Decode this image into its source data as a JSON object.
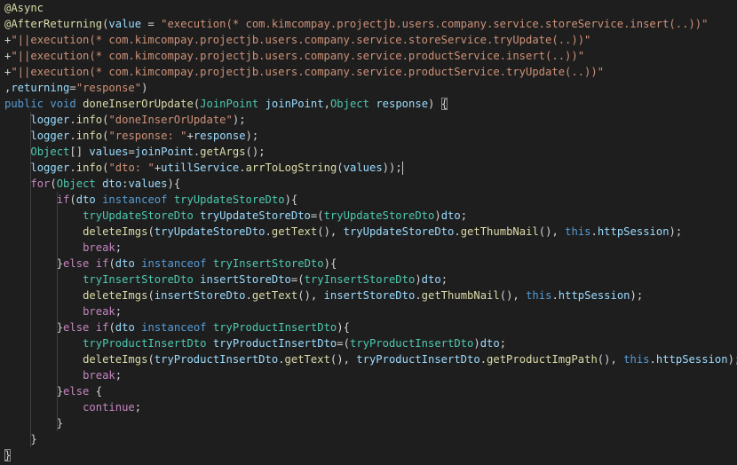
{
  "editor": {
    "theme": {
      "background": "#1e1e1e",
      "text": "#d4d4d4",
      "annotation": "#dcdcaa",
      "string": "#ce9178",
      "keyword": "#569cd6",
      "control": "#c586c0",
      "type": "#4ec9b0",
      "function": "#dcdcaa",
      "variable": "#9cdcfe"
    },
    "lines": [
      [
        [
          "ann",
          "@Async"
        ]
      ],
      [
        [
          "ann",
          "@AfterReturning"
        ],
        [
          "punc",
          "("
        ],
        [
          "var",
          "value"
        ],
        [
          "punc",
          " = "
        ],
        [
          "str",
          "\"execution(* com.kimcompay.projectjb.users.company.service.storeService.insert(..))\""
        ]
      ],
      [
        [
          "punc",
          "+"
        ],
        [
          "str",
          "\"||execution(* com.kimcompay.projectjb.users.company.service.storeService.tryUpdate(..))\""
        ]
      ],
      [
        [
          "punc",
          "+"
        ],
        [
          "str",
          "\"||execution(* com.kimcompay.projectjb.users.company.service.productService.insert(..))\""
        ]
      ],
      [
        [
          "punc",
          "+"
        ],
        [
          "str",
          "\"||execution(* com.kimcompay.projectjb.users.company.service.productService.tryUpdate(..))\""
        ]
      ],
      [
        [
          "punc",
          ","
        ],
        [
          "var",
          "returning"
        ],
        [
          "punc",
          "="
        ],
        [
          "str",
          "\"response\""
        ],
        [
          "punc",
          ")"
        ]
      ],
      [
        [
          "kw",
          "public"
        ],
        [
          "punc",
          " "
        ],
        [
          "kw",
          "void"
        ],
        [
          "punc",
          " "
        ],
        [
          "fn",
          "doneInserOrUpdate"
        ],
        [
          "punc",
          "("
        ],
        [
          "type",
          "JoinPoint"
        ],
        [
          "punc",
          " "
        ],
        [
          "var",
          "joinPoint"
        ],
        [
          "punc",
          ","
        ],
        [
          "type",
          "Object"
        ],
        [
          "punc",
          " "
        ],
        [
          "var",
          "response"
        ],
        [
          "punc",
          ") "
        ],
        [
          "brace",
          "{"
        ]
      ],
      [
        [
          "punc",
          "    "
        ],
        [
          "var",
          "logger"
        ],
        [
          "punc",
          "."
        ],
        [
          "fn",
          "info"
        ],
        [
          "punc",
          "("
        ],
        [
          "str",
          "\"doneInserOrUpdate\""
        ],
        [
          "punc",
          ");"
        ]
      ],
      [
        [
          "punc",
          "    "
        ],
        [
          "var",
          "logger"
        ],
        [
          "punc",
          "."
        ],
        [
          "fn",
          "info"
        ],
        [
          "punc",
          "("
        ],
        [
          "str",
          "\"response: \""
        ],
        [
          "punc",
          "+"
        ],
        [
          "var",
          "response"
        ],
        [
          "punc",
          ");"
        ]
      ],
      [
        [
          "punc",
          "    "
        ],
        [
          "type",
          "Object"
        ],
        [
          "punc",
          "[] "
        ],
        [
          "var",
          "values"
        ],
        [
          "punc",
          "="
        ],
        [
          "var",
          "joinPoint"
        ],
        [
          "punc",
          "."
        ],
        [
          "fn",
          "getArgs"
        ],
        [
          "punc",
          "();"
        ]
      ],
      [
        [
          "punc",
          "    "
        ],
        [
          "var",
          "logger"
        ],
        [
          "punc",
          "."
        ],
        [
          "fn",
          "info"
        ],
        [
          "punc",
          "("
        ],
        [
          "str",
          "\"dto: \""
        ],
        [
          "punc",
          "+"
        ],
        [
          "var",
          "utillService"
        ],
        [
          "punc",
          "."
        ],
        [
          "fn",
          "arrToLogString"
        ],
        [
          "punc",
          "("
        ],
        [
          "var",
          "values"
        ],
        [
          "punc",
          "));"
        ],
        [
          "cursor",
          ""
        ]
      ],
      [
        [
          "punc",
          "    "
        ],
        [
          "ctl",
          "for"
        ],
        [
          "punc",
          "("
        ],
        [
          "type",
          "Object"
        ],
        [
          "punc",
          " "
        ],
        [
          "var",
          "dto"
        ],
        [
          "punc",
          ":"
        ],
        [
          "var",
          "values"
        ],
        [
          "punc",
          "){"
        ]
      ],
      [
        [
          "punc",
          "        "
        ],
        [
          "ctl",
          "if"
        ],
        [
          "punc",
          "("
        ],
        [
          "var",
          "dto"
        ],
        [
          "punc",
          " "
        ],
        [
          "kw",
          "instanceof"
        ],
        [
          "punc",
          " "
        ],
        [
          "type",
          "tryUpdateStoreDto"
        ],
        [
          "punc",
          "){"
        ]
      ],
      [
        [
          "punc",
          "            "
        ],
        [
          "type",
          "tryUpdateStoreDto"
        ],
        [
          "punc",
          " "
        ],
        [
          "var",
          "tryUpdateStoreDto"
        ],
        [
          "punc",
          "=("
        ],
        [
          "type",
          "tryUpdateStoreDto"
        ],
        [
          "punc",
          ")"
        ],
        [
          "var",
          "dto"
        ],
        [
          "punc",
          ";"
        ]
      ],
      [
        [
          "punc",
          "            "
        ],
        [
          "fn",
          "deleteImgs"
        ],
        [
          "punc",
          "("
        ],
        [
          "var",
          "tryUpdateStoreDto"
        ],
        [
          "punc",
          "."
        ],
        [
          "fn",
          "getText"
        ],
        [
          "punc",
          "(), "
        ],
        [
          "var",
          "tryUpdateStoreDto"
        ],
        [
          "punc",
          "."
        ],
        [
          "fn",
          "getThumbNail"
        ],
        [
          "punc",
          "(), "
        ],
        [
          "kw",
          "this"
        ],
        [
          "punc",
          "."
        ],
        [
          "var",
          "httpSession"
        ],
        [
          "punc",
          ");"
        ]
      ],
      [
        [
          "punc",
          "            "
        ],
        [
          "ctl",
          "break"
        ],
        [
          "punc",
          ";"
        ]
      ],
      [
        [
          "punc",
          "        }"
        ],
        [
          "ctl",
          "else"
        ],
        [
          "punc",
          " "
        ],
        [
          "ctl",
          "if"
        ],
        [
          "punc",
          "("
        ],
        [
          "var",
          "dto"
        ],
        [
          "punc",
          " "
        ],
        [
          "kw",
          "instanceof"
        ],
        [
          "punc",
          " "
        ],
        [
          "type",
          "tryInsertStoreDto"
        ],
        [
          "punc",
          "){"
        ]
      ],
      [
        [
          "punc",
          "            "
        ],
        [
          "type",
          "tryInsertStoreDto"
        ],
        [
          "punc",
          " "
        ],
        [
          "var",
          "insertStoreDto"
        ],
        [
          "punc",
          "=("
        ],
        [
          "type",
          "tryInsertStoreDto"
        ],
        [
          "punc",
          ")"
        ],
        [
          "var",
          "dto"
        ],
        [
          "punc",
          ";"
        ]
      ],
      [
        [
          "punc",
          "            "
        ],
        [
          "fn",
          "deleteImgs"
        ],
        [
          "punc",
          "("
        ],
        [
          "var",
          "insertStoreDto"
        ],
        [
          "punc",
          "."
        ],
        [
          "fn",
          "getText"
        ],
        [
          "punc",
          "(), "
        ],
        [
          "var",
          "insertStoreDto"
        ],
        [
          "punc",
          "."
        ],
        [
          "fn",
          "getThumbNail"
        ],
        [
          "punc",
          "(), "
        ],
        [
          "kw",
          "this"
        ],
        [
          "punc",
          "."
        ],
        [
          "var",
          "httpSession"
        ],
        [
          "punc",
          ");"
        ]
      ],
      [
        [
          "punc",
          "            "
        ],
        [
          "ctl",
          "break"
        ],
        [
          "punc",
          ";"
        ]
      ],
      [
        [
          "punc",
          "        }"
        ],
        [
          "ctl",
          "else"
        ],
        [
          "punc",
          " "
        ],
        [
          "ctl",
          "if"
        ],
        [
          "punc",
          "("
        ],
        [
          "var",
          "dto"
        ],
        [
          "punc",
          " "
        ],
        [
          "kw",
          "instanceof"
        ],
        [
          "punc",
          " "
        ],
        [
          "type",
          "tryProductInsertDto"
        ],
        [
          "punc",
          "){"
        ]
      ],
      [
        [
          "punc",
          "            "
        ],
        [
          "type",
          "tryProductInsertDto"
        ],
        [
          "punc",
          " "
        ],
        [
          "var",
          "tryProductInsertDto"
        ],
        [
          "punc",
          "=("
        ],
        [
          "type",
          "tryProductInsertDto"
        ],
        [
          "punc",
          ")"
        ],
        [
          "var",
          "dto"
        ],
        [
          "punc",
          ";"
        ]
      ],
      [
        [
          "punc",
          "            "
        ],
        [
          "fn",
          "deleteImgs"
        ],
        [
          "punc",
          "("
        ],
        [
          "var",
          "tryProductInsertDto"
        ],
        [
          "punc",
          "."
        ],
        [
          "fn",
          "getText"
        ],
        [
          "punc",
          "(), "
        ],
        [
          "var",
          "tryProductInsertDto"
        ],
        [
          "punc",
          "."
        ],
        [
          "fn",
          "getProductImgPath"
        ],
        [
          "punc",
          "(), "
        ],
        [
          "kw",
          "this"
        ],
        [
          "punc",
          "."
        ],
        [
          "var",
          "httpSession"
        ],
        [
          "punc",
          ");"
        ]
      ],
      [
        [
          "punc",
          "            "
        ],
        [
          "ctl",
          "break"
        ],
        [
          "punc",
          ";"
        ]
      ],
      [
        [
          "punc",
          "        }"
        ],
        [
          "ctl",
          "else"
        ],
        [
          "punc",
          " {"
        ]
      ],
      [
        [
          "punc",
          "            "
        ],
        [
          "ctl",
          "continue"
        ],
        [
          "punc",
          ";"
        ]
      ],
      [
        [
          "punc",
          "        }"
        ]
      ],
      [
        [
          "punc",
          "    }"
        ]
      ],
      [
        [
          "brace",
          "}"
        ]
      ]
    ]
  }
}
